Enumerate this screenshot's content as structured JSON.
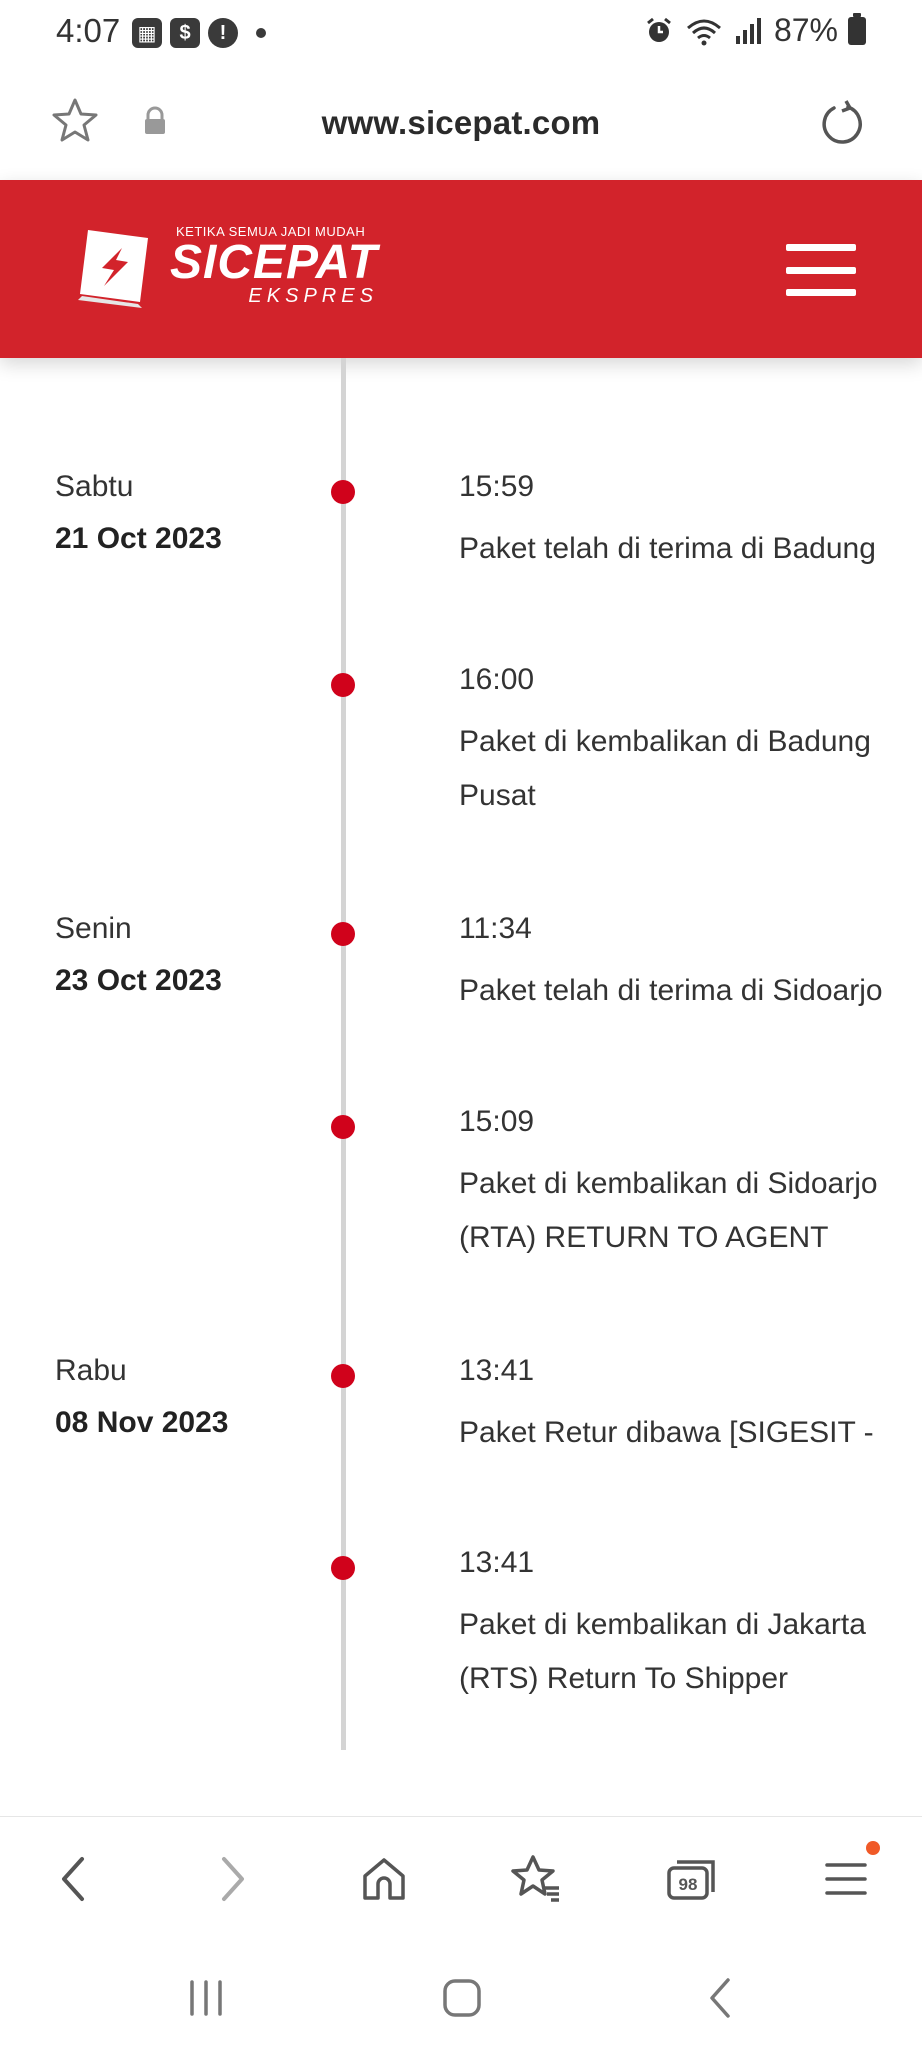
{
  "status_bar": {
    "time": "4:07",
    "battery": "87%",
    "left_icons": [
      "app-icon",
      "shopping-bag-icon",
      "alert-icon",
      "dot-icon"
    ],
    "right_icons": [
      "alarm-icon",
      "wifi-icon",
      "signal-icon",
      "battery-icon"
    ]
  },
  "browser": {
    "url": "www.sicepat.com"
  },
  "header": {
    "logo_tagline": "KETIKA SEMUA JADI MUDAH",
    "logo_brand": "SICEPAT",
    "logo_sub": "EKSPRES",
    "brand_color": "#d2232b",
    "dot_color": "#d0021b"
  },
  "timeline": [
    {
      "day": "Sabtu",
      "date": "21 Oct 2023",
      "time": "15:59",
      "lines": [
        "Paket telah di terima di Badung"
      ]
    },
    {
      "day": "",
      "date": "",
      "time": "16:00",
      "lines": [
        "Paket di kembalikan di Badung",
        "Pusat"
      ]
    },
    {
      "day": "Senin",
      "date": "23 Oct 2023",
      "time": "11:34",
      "lines": [
        "Paket telah di terima di Sidoarjo"
      ]
    },
    {
      "day": "",
      "date": "",
      "time": "15:09",
      "lines": [
        "Paket di kembalikan di Sidoarjo",
        "(RTA) RETURN TO AGENT"
      ]
    },
    {
      "day": "Rabu",
      "date": "08 Nov 2023",
      "time": "13:41",
      "lines": [
        "Paket Retur dibawa [SIGESIT -"
      ]
    },
    {
      "day": "",
      "date": "",
      "time": "13:41",
      "lines": [
        "Paket di kembalikan di Jakarta",
        "(RTS) Return To Shipper"
      ]
    }
  ],
  "bottom_nav": {
    "tabs_count": "98"
  }
}
